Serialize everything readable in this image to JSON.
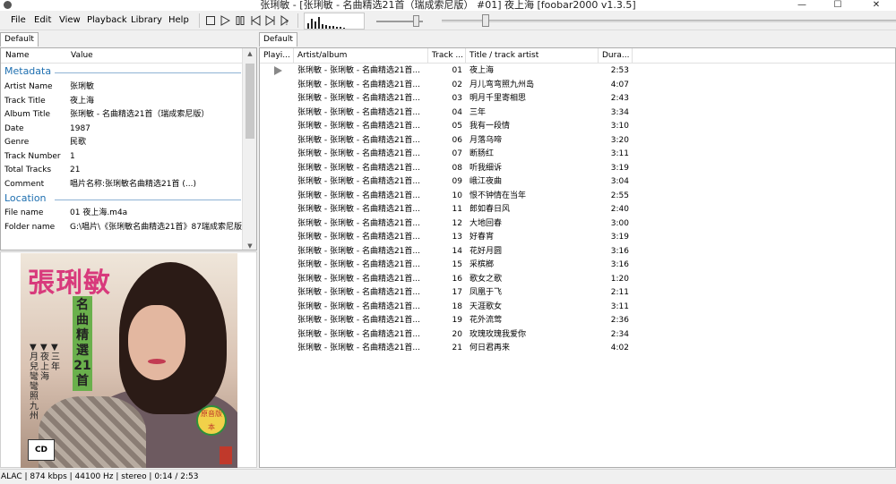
{
  "window": {
    "title": "张琍敏 - [张琍敏 - 名曲精选21首（瑞成索尼版） #01] 夜上海   [foobar2000 v1.3.5]",
    "minimize": "—",
    "maximize": "☐",
    "close": "✕"
  },
  "menu": {
    "items": [
      "File",
      "Edit",
      "View",
      "Playback",
      "Library",
      "Help"
    ]
  },
  "toolbar": {
    "buttons": [
      "stop-icon",
      "play-icon",
      "pause-icon",
      "previous-icon",
      "next-icon",
      "random-icon"
    ],
    "volume_level": 0.85,
    "seek_position": 0.088
  },
  "left_tab": {
    "label": "Default"
  },
  "properties": {
    "col_name": "Name",
    "col_value": "Value",
    "section_metadata": "Metadata",
    "metadata": [
      {
        "k": "Artist Name",
        "v": "张琍敏"
      },
      {
        "k": "Track Title",
        "v": "夜上海"
      },
      {
        "k": "Album Title",
        "v": "张琍敏 - 名曲精选21首（瑞成索尼版）"
      },
      {
        "k": "Date",
        "v": "1987"
      },
      {
        "k": "Genre",
        "v": "民歌"
      },
      {
        "k": "Track Number",
        "v": "1"
      },
      {
        "k": "Total Tracks",
        "v": "21"
      },
      {
        "k": "Comment",
        "v": "唱片名称:张琍敏名曲精选21首 (...)"
      }
    ],
    "section_location": "Location",
    "location": [
      {
        "k": "File name",
        "v": "01 夜上海.m4a"
      },
      {
        "k": "Folder name",
        "v": "G:\\唱片\\《张琍敏名曲精选21首》87瑞成索尼版"
      }
    ]
  },
  "album_art": {
    "title": "張琍敏",
    "subtitle_chars": [
      "名",
      "曲",
      "精",
      "選",
      "21",
      "首"
    ],
    "col1": "▼三年",
    "col2": "▼夜上海",
    "col3": "▼月兒彎彎照九州",
    "badge": "原音版本",
    "cd_logo": "CD"
  },
  "right_tab": {
    "label": "Default"
  },
  "playlist": {
    "columns": [
      "Playi...",
      "Artist/album",
      "Track ...",
      "Title / track artist",
      "Dura..."
    ],
    "rows": [
      {
        "artist": "张琍敏 - 张琍敏 - 名曲精选21首...",
        "num": "01",
        "title": "夜上海",
        "dur": "2:53",
        "playing": true
      },
      {
        "artist": "张琍敏 - 张琍敏 - 名曲精选21首...",
        "num": "02",
        "title": "月儿弯弯照九州岛",
        "dur": "4:07"
      },
      {
        "artist": "张琍敏 - 张琍敏 - 名曲精选21首...",
        "num": "03",
        "title": "明月千里寄相思",
        "dur": "2:43"
      },
      {
        "artist": "张琍敏 - 张琍敏 - 名曲精选21首...",
        "num": "04",
        "title": "三年",
        "dur": "3:34"
      },
      {
        "artist": "张琍敏 - 张琍敏 - 名曲精选21首...",
        "num": "05",
        "title": "我有一段情",
        "dur": "3:10"
      },
      {
        "artist": "张琍敏 - 张琍敏 - 名曲精选21首...",
        "num": "06",
        "title": "月落乌啼",
        "dur": "3:20"
      },
      {
        "artist": "张琍敏 - 张琍敏 - 名曲精选21首...",
        "num": "07",
        "title": "断肠红",
        "dur": "3:11"
      },
      {
        "artist": "张琍敏 - 张琍敏 - 名曲精选21首...",
        "num": "08",
        "title": "听我细诉",
        "dur": "3:19"
      },
      {
        "artist": "张琍敏 - 张琍敏 - 名曲精选21首...",
        "num": "09",
        "title": "峨江夜曲",
        "dur": "3:04"
      },
      {
        "artist": "张琍敏 - 张琍敏 - 名曲精选21首...",
        "num": "10",
        "title": "恨不钟情在当年",
        "dur": "2:55"
      },
      {
        "artist": "张琍敏 - 张琍敏 - 名曲精选21首...",
        "num": "11",
        "title": "郎如春日风",
        "dur": "2:40"
      },
      {
        "artist": "张琍敏 - 张琍敏 - 名曲精选21首...",
        "num": "12",
        "title": "大地回春",
        "dur": "3:00"
      },
      {
        "artist": "张琍敏 - 张琍敏 - 名曲精选21首...",
        "num": "13",
        "title": "好春宵",
        "dur": "3:19"
      },
      {
        "artist": "张琍敏 - 张琍敏 - 名曲精选21首...",
        "num": "14",
        "title": "花好月圆",
        "dur": "3:16"
      },
      {
        "artist": "张琍敏 - 张琍敏 - 名曲精选21首...",
        "num": "15",
        "title": "采槟榔",
        "dur": "3:16"
      },
      {
        "artist": "张琍敏 - 张琍敏 - 名曲精选21首...",
        "num": "16",
        "title": "歌女之歌",
        "dur": "1:20"
      },
      {
        "artist": "张琍敏 - 张琍敏 - 名曲精选21首...",
        "num": "17",
        "title": "凤凰于飞",
        "dur": "2:11"
      },
      {
        "artist": "张琍敏 - 张琍敏 - 名曲精选21首...",
        "num": "18",
        "title": "天涯歌女",
        "dur": "3:11"
      },
      {
        "artist": "张琍敏 - 张琍敏 - 名曲精选21首...",
        "num": "19",
        "title": "花外流莺",
        "dur": "2:36"
      },
      {
        "artist": "张琍敏 - 张琍敏 - 名曲精选21首...",
        "num": "20",
        "title": "玫瑰玫瑰我爱你",
        "dur": "2:34"
      },
      {
        "artist": "张琍敏 - 张琍敏 - 名曲精选21首...",
        "num": "21",
        "title": "何日君再来",
        "dur": "4:02"
      }
    ]
  },
  "status": {
    "text": "ALAC | 874 kbps | 44100 Hz | stereo | 0:14 / 2:53"
  }
}
